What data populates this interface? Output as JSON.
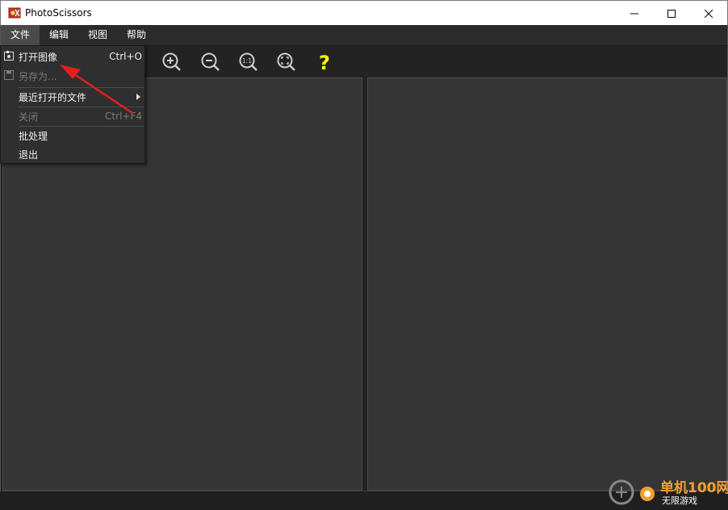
{
  "window": {
    "title": "PhotoScissors"
  },
  "menubar": {
    "items": [
      {
        "label": "文件"
      },
      {
        "label": "编辑"
      },
      {
        "label": "视图"
      },
      {
        "label": "帮助"
      }
    ]
  },
  "file_menu": {
    "items": [
      {
        "label": "打开图像",
        "shortcut": "Ctrl+O",
        "icon": "open-image-icon",
        "enabled": true
      },
      {
        "label": "另存为...",
        "shortcut": "",
        "icon": "save-icon",
        "enabled": false
      },
      {
        "label": "最近打开的文件",
        "shortcut": "",
        "submenu": true,
        "enabled": true
      },
      {
        "label": "关闭",
        "shortcut": "Ctrl+F4",
        "enabled": false
      },
      {
        "label": "批处理",
        "shortcut": "",
        "enabled": true
      },
      {
        "label": "退出",
        "shortcut": "",
        "enabled": true
      }
    ]
  },
  "toolbar": {
    "tools": [
      "zoom-in-icon",
      "zoom-out-icon",
      "actual-size-icon",
      "fit-to-window-icon",
      "help-icon"
    ],
    "help_label": "?",
    "actual_size_label": "1:1"
  },
  "watermark": {
    "line1": "单机100网",
    "line2": "无限游戏"
  },
  "colors": {
    "accent_yellow": "#ffff00",
    "annotation_red": "#e02020",
    "watermark_orange": "#f0a030"
  }
}
